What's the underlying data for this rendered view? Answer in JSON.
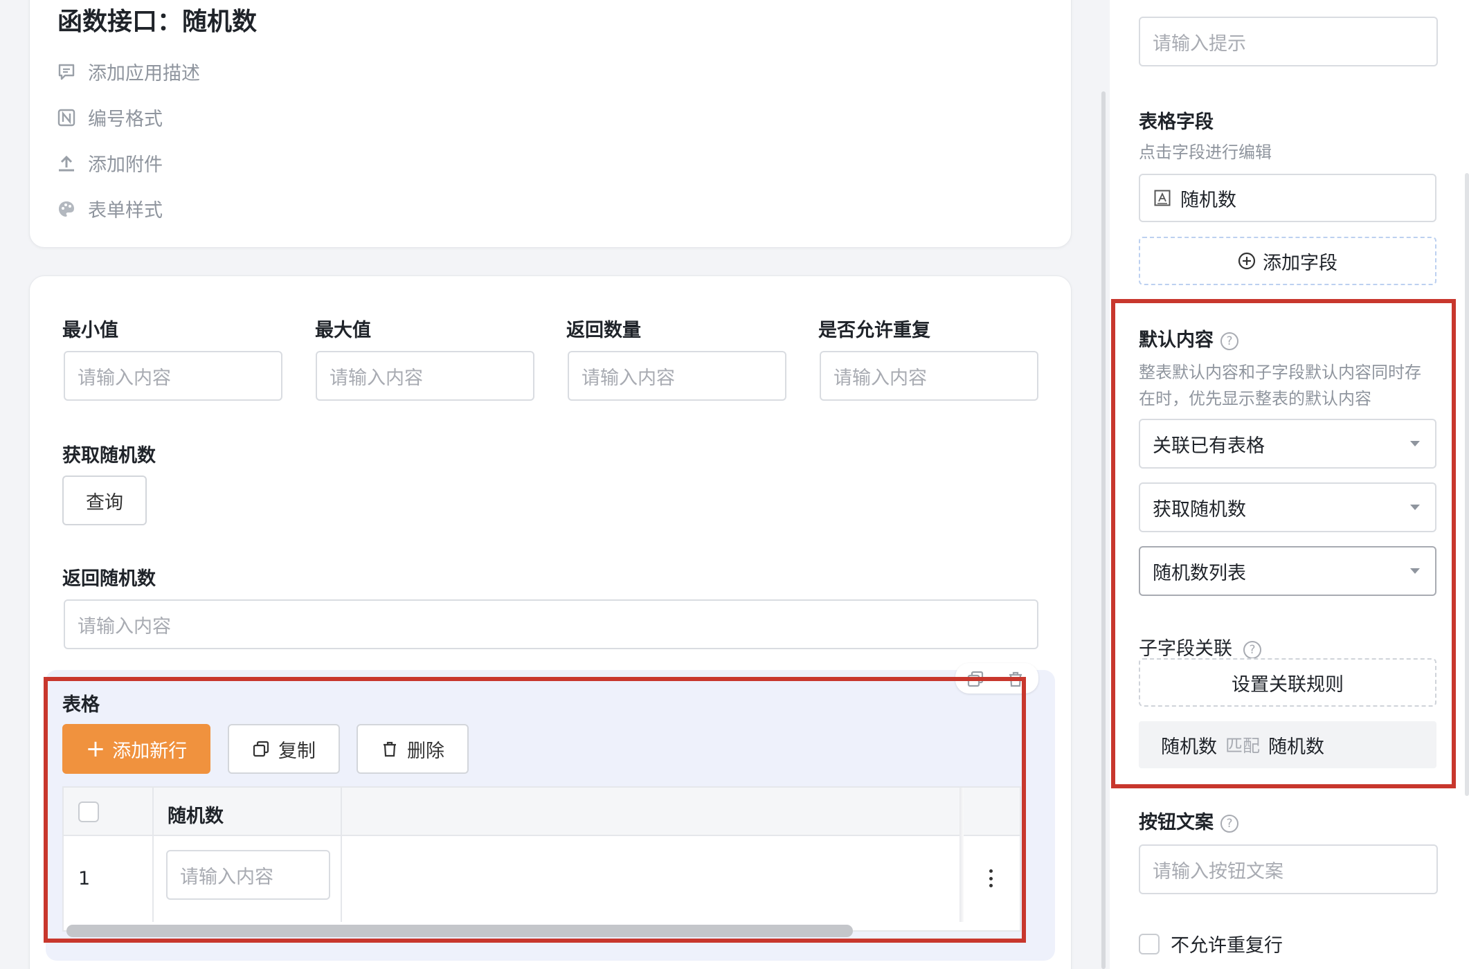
{
  "form": {
    "title": "函数接口：随机数",
    "meta_items": [
      {
        "icon": "comment-icon",
        "label": "添加应用描述"
      },
      {
        "icon": "numbering-icon",
        "label": "编号格式"
      },
      {
        "icon": "upload-icon",
        "label": "添加附件"
      },
      {
        "icon": "palette-icon",
        "label": "表单样式"
      }
    ]
  },
  "fields": {
    "min": {
      "label": "最小值",
      "placeholder": "请输入内容"
    },
    "max": {
      "label": "最大值",
      "placeholder": "请输入内容"
    },
    "count": {
      "label": "返回数量",
      "placeholder": "请输入内容"
    },
    "allow_repeat": {
      "label": "是否允许重复",
      "placeholder": "请输入内容"
    },
    "get_random": {
      "label": "获取随机数",
      "button": "查询"
    },
    "return_random": {
      "label": "返回随机数",
      "placeholder": "请输入内容"
    }
  },
  "table": {
    "title": "表格",
    "add_row": "添加新行",
    "copy": "复制",
    "delete": "删除",
    "column_header": "随机数",
    "rows": [
      {
        "index": "1",
        "placeholder": "请输入内容"
      }
    ]
  },
  "panel": {
    "hint_placeholder": "请输入提示",
    "table_fields_title": "表格字段",
    "table_fields_sub": "点击字段进行编辑",
    "field_item": "随机数",
    "add_field": "添加字段",
    "default_title": "默认内容",
    "default_desc_line1": "整表默认内容和子字段默认内容同时存",
    "default_desc_line2": "在时，优先显示整表的默认内容",
    "select1": "关联已有表格",
    "select2": "获取随机数",
    "select3": "随机数列表",
    "sub_link_title": "子字段关联",
    "set_rule": "设置关联规则",
    "mapping_left": "随机数",
    "mapping_mid": "匹配",
    "mapping_right": "随机数",
    "button_text_title": "按钮文案",
    "button_text_placeholder": "请输入按钮文案",
    "no_repeat": "不允许重复行",
    "help_glyph": "?"
  },
  "colors": {
    "accent": "#f0923e",
    "highlight": "#c8372d",
    "border": "#d9dce1"
  }
}
